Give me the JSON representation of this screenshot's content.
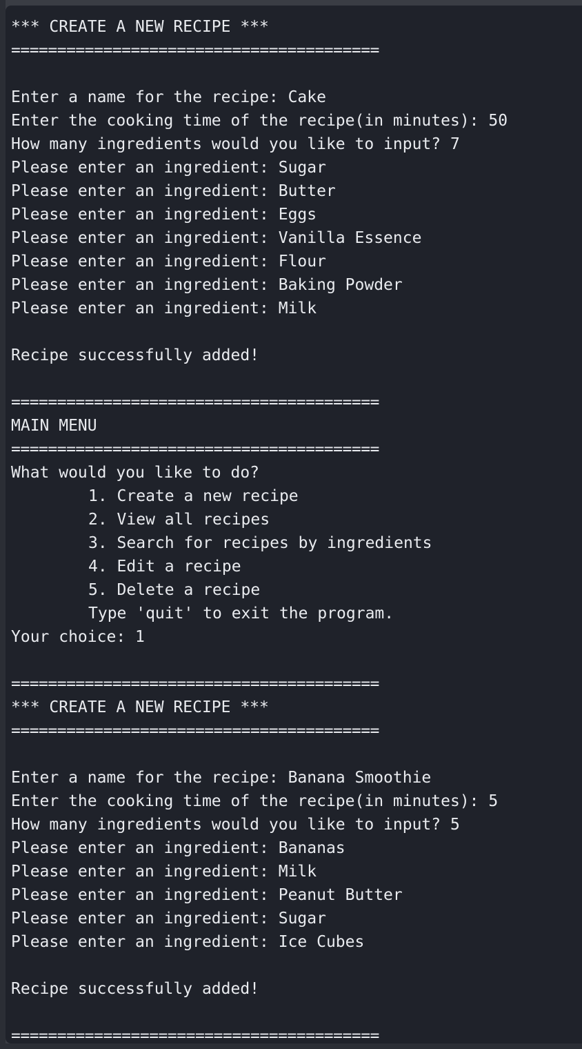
{
  "terminal": {
    "lines": [
      {
        "text": "*** CREATE A NEW RECIPE ***",
        "type": "text"
      },
      {
        "text": "========================================",
        "type": "rule"
      },
      {
        "text": "",
        "type": "blank"
      },
      {
        "text": "Enter a name for the recipe: Cake",
        "type": "text"
      },
      {
        "text": "Enter the cooking time of the recipe(in minutes): 50",
        "type": "text"
      },
      {
        "text": "How many ingredients would you like to input? 7",
        "type": "text"
      },
      {
        "text": "Please enter an ingredient: Sugar",
        "type": "text"
      },
      {
        "text": "Please enter an ingredient: Butter",
        "type": "text"
      },
      {
        "text": "Please enter an ingredient: Eggs",
        "type": "text"
      },
      {
        "text": "Please enter an ingredient: Vanilla Essence",
        "type": "text"
      },
      {
        "text": "Please enter an ingredient: Flour",
        "type": "text"
      },
      {
        "text": "Please enter an ingredient: Baking Powder",
        "type": "text"
      },
      {
        "text": "Please enter an ingredient: Milk",
        "type": "text"
      },
      {
        "text": "",
        "type": "blank"
      },
      {
        "text": "Recipe successfully added!",
        "type": "text"
      },
      {
        "text": "",
        "type": "blank"
      },
      {
        "text": "========================================",
        "type": "rule"
      },
      {
        "text": "MAIN MENU",
        "type": "text"
      },
      {
        "text": "========================================",
        "type": "rule"
      },
      {
        "text": "What would you like to do?",
        "type": "text"
      },
      {
        "text": "1. Create a new recipe",
        "type": "indent"
      },
      {
        "text": "2. View all recipes",
        "type": "indent"
      },
      {
        "text": "3. Search for recipes by ingredients",
        "type": "indent"
      },
      {
        "text": "4. Edit a recipe",
        "type": "indent"
      },
      {
        "text": "5. Delete a recipe",
        "type": "indent"
      },
      {
        "text": "Type 'quit' to exit the program.",
        "type": "indent"
      },
      {
        "text": "Your choice: 1",
        "type": "text"
      },
      {
        "text": "",
        "type": "blank"
      },
      {
        "text": "========================================",
        "type": "rule"
      },
      {
        "text": "*** CREATE A NEW RECIPE ***",
        "type": "text"
      },
      {
        "text": "========================================",
        "type": "rule"
      },
      {
        "text": "",
        "type": "blank"
      },
      {
        "text": "Enter a name for the recipe: Banana Smoothie",
        "type": "text"
      },
      {
        "text": "Enter the cooking time of the recipe(in minutes): 5",
        "type": "text"
      },
      {
        "text": "How many ingredients would you like to input? 5",
        "type": "text"
      },
      {
        "text": "Please enter an ingredient: Bananas",
        "type": "text"
      },
      {
        "text": "Please enter an ingredient: Milk",
        "type": "text"
      },
      {
        "text": "Please enter an ingredient: Peanut Butter",
        "type": "text"
      },
      {
        "text": "Please enter an ingredient: Sugar",
        "type": "text"
      },
      {
        "text": "Please enter an ingredient: Ice Cubes",
        "type": "text"
      },
      {
        "text": "",
        "type": "blank"
      },
      {
        "text": "Recipe successfully added!",
        "type": "text"
      },
      {
        "text": "",
        "type": "blank"
      },
      {
        "text": "========================================",
        "type": "rule"
      }
    ]
  },
  "colors": {
    "background": "#1f222a",
    "foreground": "#e9ebef"
  }
}
